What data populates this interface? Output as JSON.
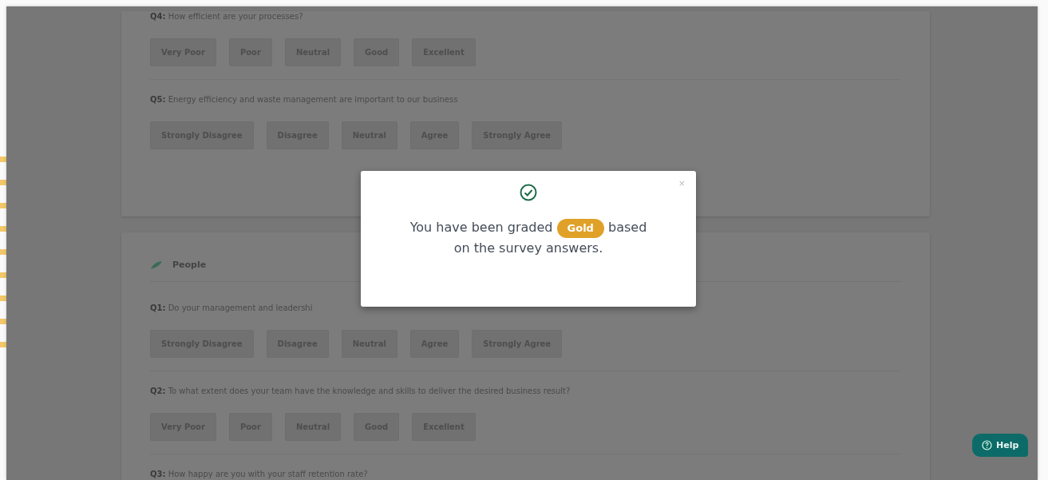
{
  "sections": [
    {
      "questions": [
        {
          "text": "**Q4:** How efficient are your processes?",
          "options": [
            "Very Poor",
            "Poor",
            "Neutral",
            "Good",
            "Excellent"
          ]
        },
        {
          "text": "**Q5:** Energy efficiency and waste management are important to our business",
          "options": [
            "Strongly Disagree",
            "Disagree",
            "Neutral",
            "Agree",
            "Strongly Agree"
          ]
        }
      ]
    },
    {
      "title": "People",
      "questions": [
        {
          "text": "**Q1:** Do your management and leadershi",
          "options": [
            "Strongly Disagree",
            "Disagree",
            "Neutral",
            "Agree",
            "Strongly Agree"
          ]
        },
        {
          "text": "**Q2:** To what extent does your team have the knowledge and skills to deliver the desired business result?",
          "options": [
            "Very Poor",
            "Poor",
            "Neutral",
            "Good",
            "Excellent"
          ]
        },
        {
          "text": "**Q3:** How happy are you with your staff retention rate?"
        }
      ]
    }
  ],
  "modal": {
    "close": "×",
    "message_before": "You have been graded",
    "grade": "Gold",
    "message_after": "based",
    "message_line2": "on the survey answers."
  },
  "help_button": {
    "label": "Help"
  }
}
